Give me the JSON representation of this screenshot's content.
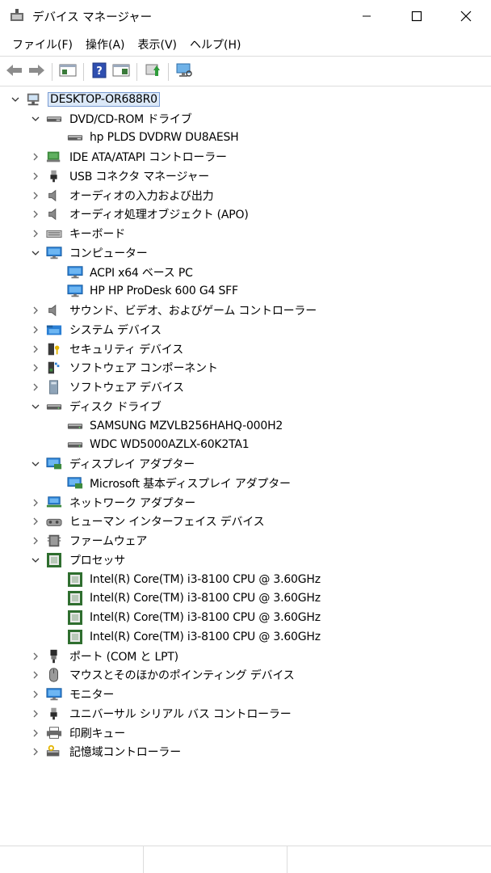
{
  "window": {
    "title": "デバイス マネージャー"
  },
  "menu": [
    "ファイル(F)",
    "操作(A)",
    "表示(V)",
    "ヘルプ(H)"
  ],
  "toolbar": [
    {
      "name": "back-icon"
    },
    {
      "name": "forward-icon"
    },
    {
      "sep": true
    },
    {
      "name": "properties-view-icon"
    },
    {
      "sep": true
    },
    {
      "name": "help-icon"
    },
    {
      "name": "action-pane-icon"
    },
    {
      "sep": true
    },
    {
      "name": "update-driver-icon"
    },
    {
      "sep": true
    },
    {
      "name": "scan-hardware-icon"
    }
  ],
  "tree": [
    {
      "level": 0,
      "expand": "open",
      "icon": "computer-network",
      "label": "DESKTOP-OR688R0",
      "root": true
    },
    {
      "level": 1,
      "expand": "open",
      "icon": "dvd",
      "label": "DVD/CD-ROM ドライブ"
    },
    {
      "level": 2,
      "expand": "none",
      "icon": "dvd",
      "label": "hp PLDS DVDRW  DU8AESH"
    },
    {
      "level": 1,
      "expand": "closed",
      "icon": "ide",
      "label": "IDE ATA/ATAPI コントローラー"
    },
    {
      "level": 1,
      "expand": "closed",
      "icon": "usb",
      "label": "USB コネクタ マネージャー"
    },
    {
      "level": 1,
      "expand": "closed",
      "icon": "speaker",
      "label": "オーディオの入力および出力"
    },
    {
      "level": 1,
      "expand": "closed",
      "icon": "speaker",
      "label": "オーディオ処理オブジェクト (APO)"
    },
    {
      "level": 1,
      "expand": "closed",
      "icon": "keyboard",
      "label": "キーボード"
    },
    {
      "level": 1,
      "expand": "open",
      "icon": "monitor",
      "label": "コンピューター"
    },
    {
      "level": 2,
      "expand": "none",
      "icon": "monitor",
      "label": "ACPI x64 ベース PC"
    },
    {
      "level": 2,
      "expand": "none",
      "icon": "monitor",
      "label": "HP HP ProDesk 600 G4 SFF"
    },
    {
      "level": 1,
      "expand": "closed",
      "icon": "speaker",
      "label": "サウンド、ビデオ、およびゲーム コントローラー"
    },
    {
      "level": 1,
      "expand": "closed",
      "icon": "system-folder",
      "label": "システム デバイス"
    },
    {
      "level": 1,
      "expand": "closed",
      "icon": "security",
      "label": "セキュリティ デバイス"
    },
    {
      "level": 1,
      "expand": "closed",
      "icon": "software-component",
      "label": "ソフトウェア コンポーネント"
    },
    {
      "level": 1,
      "expand": "closed",
      "icon": "software-device",
      "label": "ソフトウェア デバイス"
    },
    {
      "level": 1,
      "expand": "open",
      "icon": "disk",
      "label": "ディスク ドライブ"
    },
    {
      "level": 2,
      "expand": "none",
      "icon": "disk",
      "label": "SAMSUNG MZVLB256HAHQ-000H2"
    },
    {
      "level": 2,
      "expand": "none",
      "icon": "disk",
      "label": "WDC WD5000AZLX-60K2TA1"
    },
    {
      "level": 1,
      "expand": "open",
      "icon": "display-adapter",
      "label": "ディスプレイ アダプター"
    },
    {
      "level": 2,
      "expand": "none",
      "icon": "display-adapter",
      "label": "Microsoft 基本ディスプレイ アダプター"
    },
    {
      "level": 1,
      "expand": "closed",
      "icon": "network",
      "label": "ネットワーク アダプター"
    },
    {
      "level": 1,
      "expand": "closed",
      "icon": "hid",
      "label": "ヒューマン インターフェイス デバイス"
    },
    {
      "level": 1,
      "expand": "closed",
      "icon": "firmware",
      "label": "ファームウェア"
    },
    {
      "level": 1,
      "expand": "open",
      "icon": "processor",
      "label": "プロセッサ"
    },
    {
      "level": 2,
      "expand": "none",
      "icon": "processor",
      "label": "Intel(R) Core(TM) i3-8100 CPU @ 3.60GHz"
    },
    {
      "level": 2,
      "expand": "none",
      "icon": "processor",
      "label": "Intel(R) Core(TM) i3-8100 CPU @ 3.60GHz"
    },
    {
      "level": 2,
      "expand": "none",
      "icon": "processor",
      "label": "Intel(R) Core(TM) i3-8100 CPU @ 3.60GHz"
    },
    {
      "level": 2,
      "expand": "none",
      "icon": "processor",
      "label": "Intel(R) Core(TM) i3-8100 CPU @ 3.60GHz"
    },
    {
      "level": 1,
      "expand": "closed",
      "icon": "port",
      "label": "ポート (COM と LPT)"
    },
    {
      "level": 1,
      "expand": "closed",
      "icon": "mouse",
      "label": "マウスとそのほかのポインティング デバイス"
    },
    {
      "level": 1,
      "expand": "closed",
      "icon": "monitor",
      "label": "モニター"
    },
    {
      "level": 1,
      "expand": "closed",
      "icon": "usb",
      "label": "ユニバーサル シリアル バス コントローラー"
    },
    {
      "level": 1,
      "expand": "closed",
      "icon": "printer",
      "label": "印刷キュー"
    },
    {
      "level": 1,
      "expand": "closed",
      "icon": "storage-controller",
      "label": "記憶域コントローラー"
    }
  ]
}
